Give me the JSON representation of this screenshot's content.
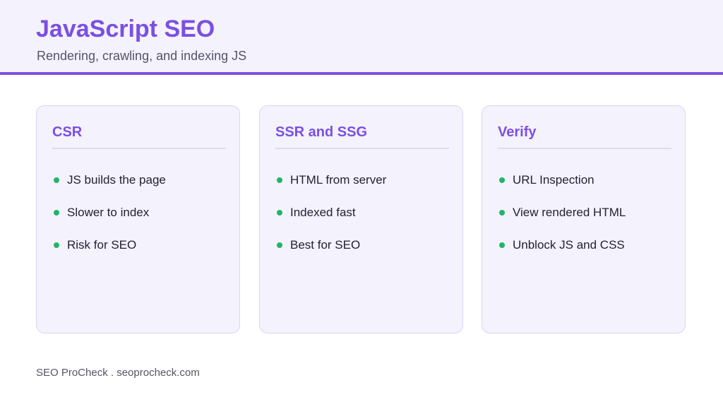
{
  "header": {
    "title": "JavaScript SEO",
    "subtitle": "Rendering, crawling, and indexing JS"
  },
  "cards": [
    {
      "title": "CSR",
      "items": [
        "JS builds the page",
        "Slower to index",
        "Risk for SEO"
      ]
    },
    {
      "title": "SSR and SSG",
      "items": [
        "HTML from server",
        "Indexed fast",
        "Best for SEO"
      ]
    },
    {
      "title": "Verify",
      "items": [
        "URL Inspection",
        "View rendered HTML",
        "Unblock JS and CSS"
      ]
    }
  ],
  "footer": {
    "text": "SEO ProCheck . seoprocheck.com"
  },
  "colors": {
    "accent": "#7b4fe3",
    "bullet": "#22b567",
    "header_bg": "#f4f2fd",
    "card_bg": "#f4f2fd"
  },
  "icons": {
    "bullet": "bullet-dot-icon"
  }
}
